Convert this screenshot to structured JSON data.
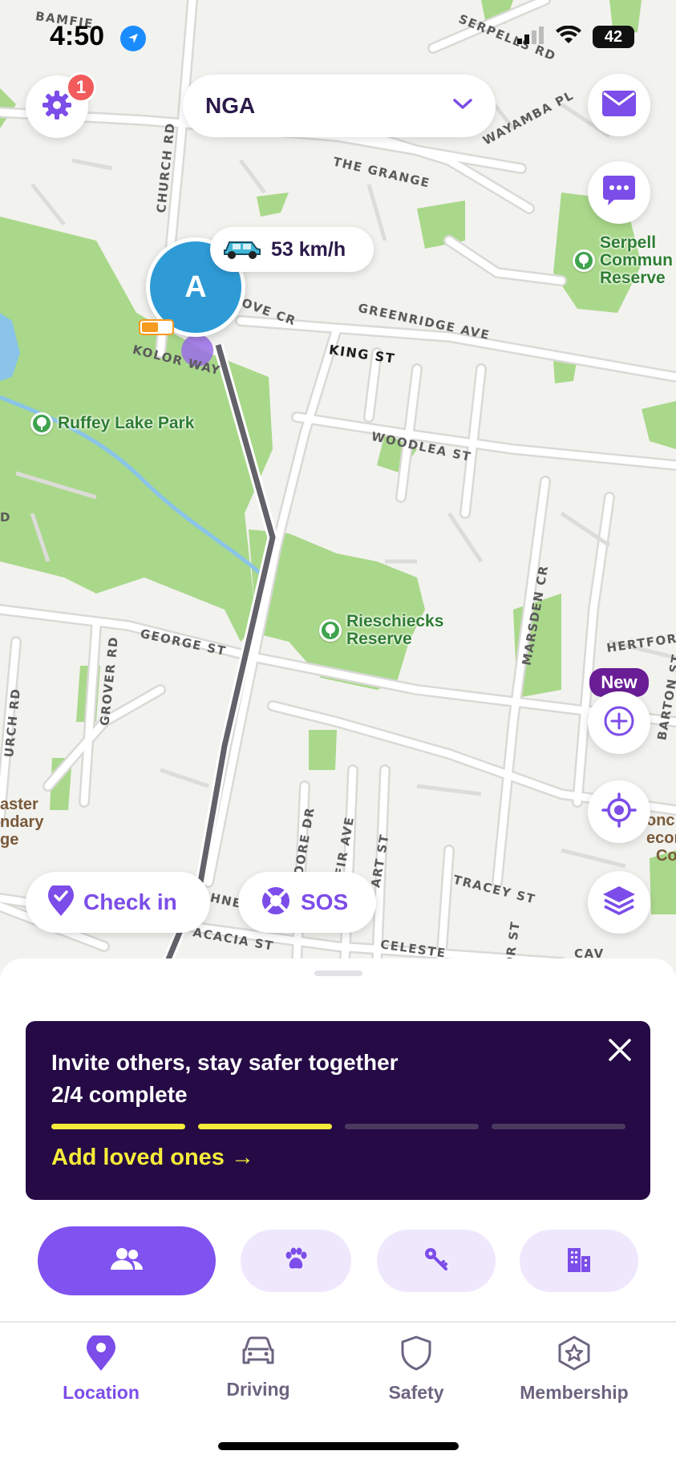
{
  "status_bar": {
    "time": "4:50",
    "battery": "42"
  },
  "header": {
    "circle_name": "NGA",
    "settings_badge_count": "1"
  },
  "map": {
    "streets": {
      "bamfield": "BAMFIE",
      "serpells": "SERPELLS RD",
      "wayamba": "WAYAMBA PL",
      "church_top": "CHURCH RD",
      "the_grange": "THE GRANGE",
      "grove_cr": "OVE CR",
      "greenridge": "GREENRIDGE AVE",
      "king_st": "KING ST",
      "kolor_way": "KOLOR WAY",
      "woodlea": "WOODLEA ST",
      "george_st": "GEORGE ST",
      "grover_rd": "GROVER RD",
      "church_bottom": "URCH RD",
      "marsden": "MARSDEN CR",
      "hertford": "HERTFORD",
      "barton": "BARTON ST",
      "moore_dr": "OORE DR",
      "fir_ave": "FIR AVE",
      "art_st": "ART ST",
      "tracey": "TRACEY ST",
      "acacia": "ACACIA ST",
      "celeste": "CELESTE",
      "cav": "CAV",
      "hne": "HNE",
      "or_st": "OR ST",
      "frag_d": "D"
    },
    "pois": {
      "ruffey": "Ruffey Lake Park",
      "riesch_1": "Rieschiecks",
      "riesch_2": "Reserve",
      "serpell_1": "Serpell",
      "serpell_2": "Commun",
      "serpell_3": "Reserve"
    },
    "edge_texts": {
      "left_1": "aster",
      "left_2": "ndary",
      "left_3": "ge",
      "right_1": "onc",
      "right_2": "econ",
      "right_3": "Co"
    },
    "member": {
      "initial": "A",
      "speed": "53 km/h",
      "battery_level": 0.55
    }
  },
  "actions": {
    "new_badge": "New",
    "check_in": "Check in",
    "sos": "SOS"
  },
  "invite_card": {
    "title": "Invite others, stay safer together",
    "progress_text": "2/4 complete",
    "steps_total": 4,
    "steps_done": 2,
    "cta": "Add loved ones →"
  },
  "filter_chips": [
    {
      "icon": "people-icon",
      "active": true
    },
    {
      "icon": "paw-icon",
      "active": false
    },
    {
      "icon": "key-icon",
      "active": false
    },
    {
      "icon": "building-icon",
      "active": false
    }
  ],
  "tabs": [
    {
      "label": "Location",
      "icon": "location-pin-icon",
      "active": true
    },
    {
      "label": "Driving",
      "icon": "car-icon",
      "active": false
    },
    {
      "label": "Safety",
      "icon": "shield-icon",
      "active": false
    },
    {
      "label": "Membership",
      "icon": "star-badge-icon",
      "active": false
    }
  ],
  "colors": {
    "accent": "#7c4de8",
    "card_bg": "#250a45",
    "highlight": "#f6ec3a",
    "park": "#a9d88a",
    "map_bg": "#f2f2ef"
  }
}
